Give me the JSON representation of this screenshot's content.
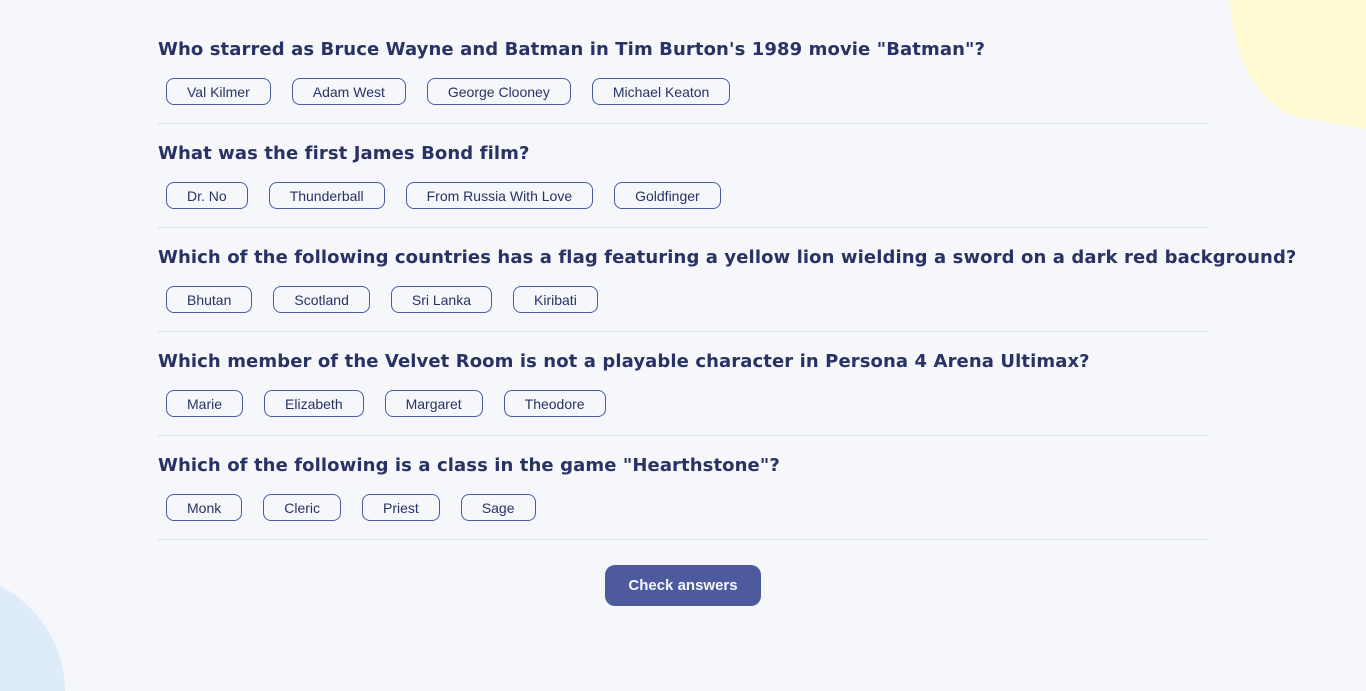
{
  "questions": [
    {
      "text": "Who starred as Bruce Wayne and Batman in Tim Burton's 1989 movie \"Batman\"?",
      "answers": [
        "Val Kilmer",
        "Adam West",
        "George Clooney",
        "Michael Keaton"
      ]
    },
    {
      "text": "What was the first James Bond film?",
      "answers": [
        "Dr. No",
        "Thunderball",
        "From Russia With Love",
        "Goldfinger"
      ]
    },
    {
      "text": "Which of the following countries has a flag featuring a yellow lion wielding a sword on a dark red background?",
      "answers": [
        "Bhutan",
        "Scotland",
        "Sri Lanka",
        "Kiribati"
      ]
    },
    {
      "text": "Which member of the Velvet Room is not a playable character in Persona 4 Arena Ultimax?",
      "answers": [
        "Marie",
        "Elizabeth",
        "Margaret",
        "Theodore"
      ]
    },
    {
      "text": "Which of the following is a class in the game \"Hearthstone\"?",
      "answers": [
        "Monk",
        "Cleric",
        "Priest",
        "Sage"
      ]
    }
  ],
  "check_button_label": "Check answers",
  "colors": {
    "background": "#F5F7FB",
    "text": "#293264",
    "accent": "#4D5B9E",
    "divider": "#DBDEF0",
    "blob_yellow": "#FFFAD1",
    "blob_blue": "#DEEBF8"
  }
}
